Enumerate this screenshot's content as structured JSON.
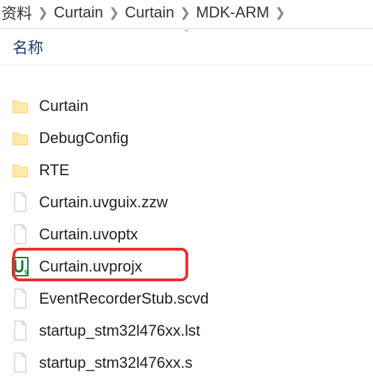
{
  "breadcrumb": {
    "segments": [
      "资料",
      "Curtain",
      "Curtain",
      "MDK-ARM"
    ]
  },
  "column_header": "名称",
  "items": [
    {
      "name": "Curtain",
      "type": "folder"
    },
    {
      "name": "DebugConfig",
      "type": "folder"
    },
    {
      "name": "RTE",
      "type": "folder"
    },
    {
      "name": "Curtain.uvguix.zzw",
      "type": "file"
    },
    {
      "name": "Curtain.uvoptx",
      "type": "file"
    },
    {
      "name": "Curtain.uvprojx",
      "type": "uvproj",
      "highlighted": true
    },
    {
      "name": "EventRecorderStub.scvd",
      "type": "file"
    },
    {
      "name": "startup_stm32l476xx.lst",
      "type": "file"
    },
    {
      "name": "startup_stm32l476xx.s",
      "type": "file"
    }
  ]
}
